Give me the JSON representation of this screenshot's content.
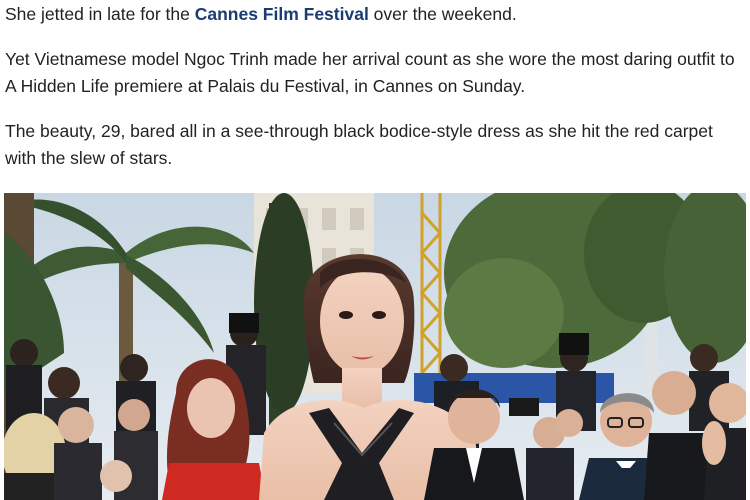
{
  "article": {
    "p1_before": "She jetted in late for the ",
    "p1_link": "Cannes Film Festival",
    "p1_after": " over the weekend.",
    "p2": "Yet Vietnamese model Ngoc Trinh made her arrival count as she wore the most daring outfit to A Hidden Life premiere at Palais du Festival, in Cannes on Sunday.",
    "p3": "The beauty, 29, bared all in a see-through black bodice-style dress as she hit the red carpet with the slew of stars."
  },
  "colors": {
    "link": "#1b3c73",
    "text": "#222222"
  }
}
